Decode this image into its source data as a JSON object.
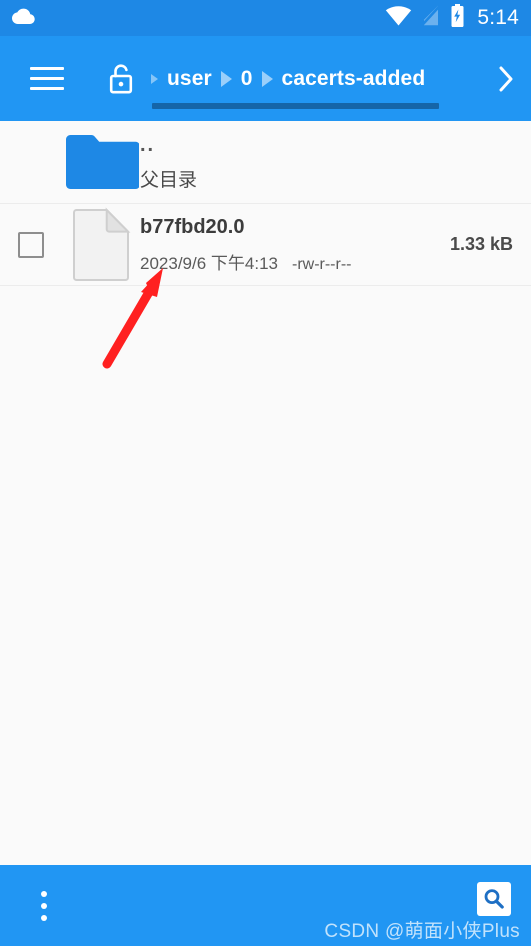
{
  "status_bar": {
    "notification_icon": "cloud-icon",
    "wifi_icon": "wifi-icon",
    "signal_icon": "signal-off-icon",
    "battery_icon": "battery-charging-icon",
    "time": "5:14"
  },
  "app_bar": {
    "menu_icon": "hamburger-menu-icon",
    "lock_icon": "unlocked-padlock-icon",
    "next_icon": "chevron-right-icon",
    "breadcrumbs": [
      {
        "label": "user"
      },
      {
        "label": "0"
      },
      {
        "label": "cacerts-added"
      }
    ]
  },
  "list": {
    "parent_row": {
      "icon": "folder-icon",
      "name": "..",
      "description": "父目录"
    },
    "files": [
      {
        "icon": "document-file-icon",
        "name": "b77fbd20.0",
        "date": "2023/9/6 下午4:13",
        "permissions": "-rw-r--r--",
        "size": "1.33 kB",
        "selected": false
      }
    ]
  },
  "bottom_bar": {
    "overflow_icon": "more-vertical-icon",
    "search_icon": "search-icon"
  },
  "watermark": {
    "text": "CSDN @萌面小侠Plus"
  },
  "colors": {
    "primary": "#2196F3",
    "status_bar": "#1E88E5",
    "folder": "#1E88E5",
    "scroll_indicator": "#1565A8",
    "background": "#fafafa",
    "annotation": "#FF2020"
  }
}
